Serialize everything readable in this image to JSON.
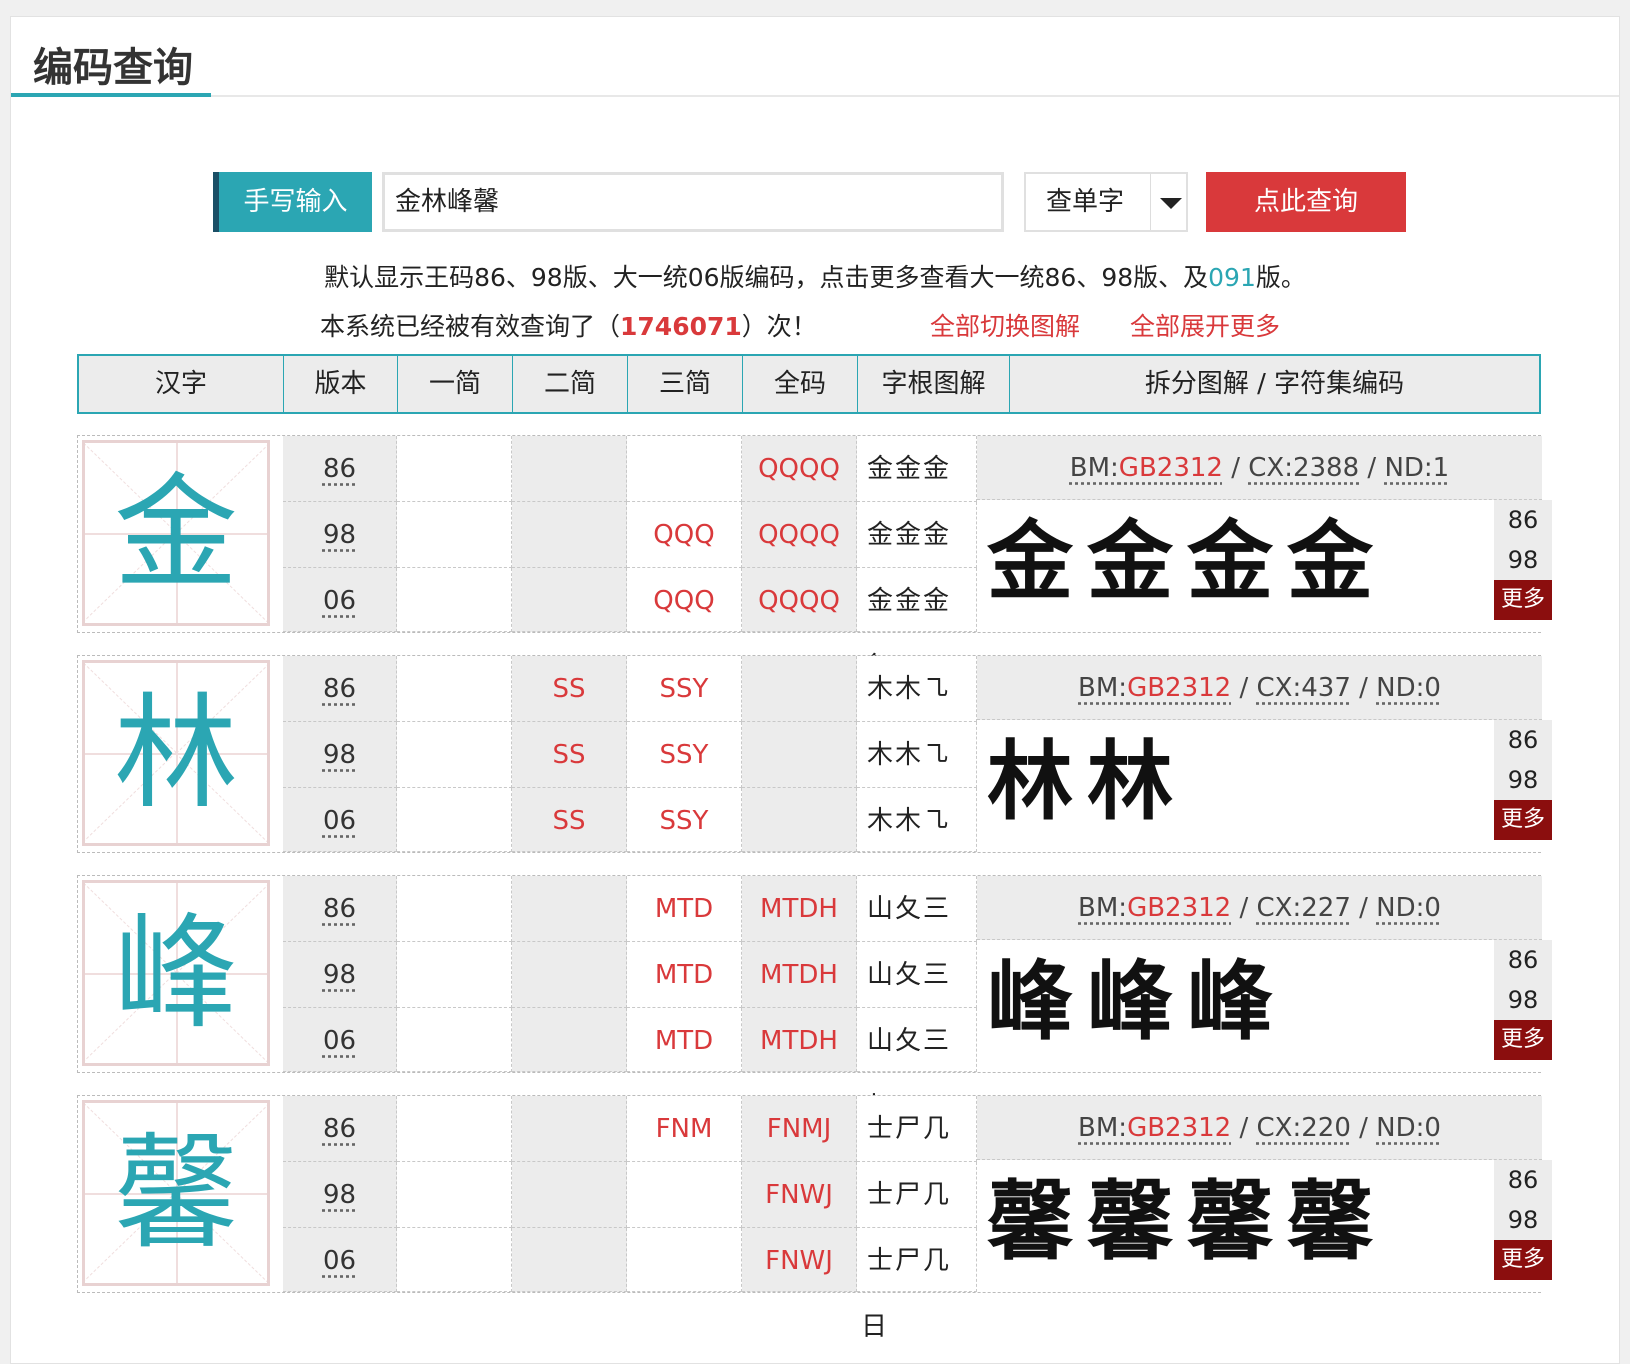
{
  "page": {
    "title": "编码查询"
  },
  "search": {
    "handwrite_label": "手写输入",
    "query_value": "金林峰馨",
    "mode_label": "查单字",
    "submit_label": "点此查询"
  },
  "info": {
    "line1_prefix": "默认显示王码86、98版、大一统06版编码，点击更多查看大一统86、98版、及",
    "line1_highlight": "091",
    "line1_suffix": "版。",
    "line2_prefix": "本系统已经被有效查询了（",
    "count": "1746071",
    "line2_suffix": "）次！",
    "link_switch": "全部切换图解",
    "link_expand": "全部展开更多"
  },
  "table": {
    "headers": [
      "汉字",
      "版本",
      "一简",
      "二简",
      "三简",
      "全码",
      "字根图解",
      "拆分图解 / 字符集编码"
    ]
  },
  "colors": {
    "accent": "#2ba6b3",
    "red": "#d9393b",
    "dark_red": "#8b0e0e"
  },
  "characters": [
    {
      "char": "金",
      "rows": [
        {
          "ver": "86",
          "j1": "",
          "j2": "",
          "j3": "",
          "full": "QQQQ",
          "roots": "金金金金"
        },
        {
          "ver": "98",
          "j1": "",
          "j2": "",
          "j3": "QQQ",
          "full": "QQQQ",
          "roots": "金金金金"
        },
        {
          "ver": "06",
          "j1": "",
          "j2": "",
          "j3": "QQQ",
          "full": "QQQQ",
          "roots": "金金金金"
        }
      ],
      "bm_label": "BM:",
      "bm_value": "GB2312",
      "cx": "CX:2388",
      "nd": "ND:1",
      "calligraphy": "金金金金",
      "tabs": [
        "86",
        "98"
      ],
      "more": "更多"
    },
    {
      "char": "林",
      "rows": [
        {
          "ver": "86",
          "j1": "",
          "j2": "SS",
          "j3": "SSY",
          "full": "",
          "roots": "木木㇈"
        },
        {
          "ver": "98",
          "j1": "",
          "j2": "SS",
          "j3": "SSY",
          "full": "",
          "roots": "木木㇈"
        },
        {
          "ver": "06",
          "j1": "",
          "j2": "SS",
          "j3": "SSY",
          "full": "",
          "roots": "木木㇈"
        }
      ],
      "bm_label": "BM:",
      "bm_value": "GB2312",
      "cx": "CX:437",
      "nd": "ND:0",
      "calligraphy": "林林",
      "tabs": [
        "86",
        "98"
      ],
      "more": "更多"
    },
    {
      "char": "峰",
      "rows": [
        {
          "ver": "86",
          "j1": "",
          "j2": "",
          "j3": "MTD",
          "full": "MTDH",
          "roots": "山夂三丨"
        },
        {
          "ver": "98",
          "j1": "",
          "j2": "",
          "j3": "MTD",
          "full": "MTDH",
          "roots": "山夂三丨"
        },
        {
          "ver": "06",
          "j1": "",
          "j2": "",
          "j3": "MTD",
          "full": "MTDH",
          "roots": "山夂三丨"
        }
      ],
      "bm_label": "BM:",
      "bm_value": "GB2312",
      "cx": "CX:227",
      "nd": "ND:0",
      "calligraphy": "峰峰峰",
      "tabs": [
        "86",
        "98"
      ],
      "more": "更多"
    },
    {
      "char": "馨",
      "rows": [
        {
          "ver": "86",
          "j1": "",
          "j2": "",
          "j3": "FNM",
          "full": "FNMJ",
          "roots": "士尸几日"
        },
        {
          "ver": "98",
          "j1": "",
          "j2": "",
          "j3": "",
          "full": "FNWJ",
          "roots": "士尸几日"
        },
        {
          "ver": "06",
          "j1": "",
          "j2": "",
          "j3": "",
          "full": "FNWJ",
          "roots": "士尸几日"
        }
      ],
      "bm_label": "BM:",
      "bm_value": "GB2312",
      "cx": "CX:220",
      "nd": "ND:0",
      "calligraphy": "馨馨馨馨",
      "tabs": [
        "86",
        "98"
      ],
      "more": "更多"
    }
  ]
}
